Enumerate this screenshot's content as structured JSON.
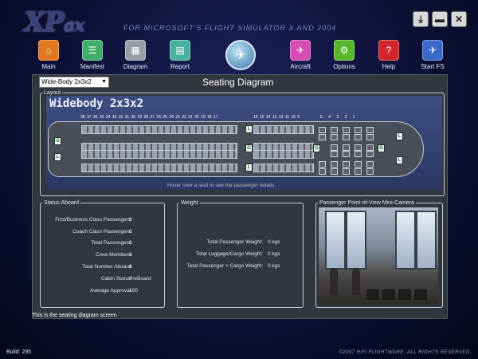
{
  "app": {
    "logo_main": "XP",
    "logo_suffix": "ax",
    "subtitle": "FOR MICROSOFT'S FLIGHT SIMULATOR X AND 2004",
    "window_buttons": [
      "download-icon",
      "minimize-icon",
      "close-icon"
    ]
  },
  "nav": {
    "left": [
      {
        "label": "Main",
        "icon": "home-icon",
        "color": "#e3791f"
      },
      {
        "label": "Manifest",
        "icon": "manifest-icon",
        "color": "#3fae6b"
      },
      {
        "label": "Diagram",
        "icon": "diagram-icon",
        "color": "#9a9ea6"
      },
      {
        "label": "Report",
        "icon": "report-icon",
        "color": "#47b2a2"
      }
    ],
    "right": [
      {
        "label": "Aircraft",
        "icon": "aircraft-icon",
        "color": "#d64db6"
      },
      {
        "label": "Options",
        "icon": "options-icon",
        "color": "#58b82a"
      },
      {
        "label": "Help",
        "icon": "help-icon",
        "color": "#d1262b"
      },
      {
        "label": "Start FS",
        "icon": "plane-icon",
        "color": "#3a69c9"
      }
    ]
  },
  "diagram": {
    "aircraft_select": "Wide-Body 2x3x2",
    "title": "Seating Diagram"
  },
  "layout": {
    "legend": "Layout",
    "aircraft_title": "Widebody 2x3x2",
    "rows_coach_left": "38 37 36 35 34 33 32 31 30 29 28 27 26 25 24 23 22 21 20 19 18 17",
    "rows_coach_right": "16 15 14 13 12 11 10 9",
    "rows_first": "5      4      3      2      1",
    "hint": "Hover over a seat to see the passenger details."
  },
  "status": {
    "legend": "Status Aboard",
    "rows": [
      {
        "label": "First/Business Class Passengers:",
        "value": "0"
      },
      {
        "label": "Coach Class Passengers:",
        "value": "0"
      },
      {
        "label": "Total Passengers:",
        "value": "0"
      },
      {
        "label": "Crew Members:",
        "value": "8"
      },
      {
        "label": "Total Number Aboard:",
        "value": "8"
      },
      {
        "label": "Cabin Status:",
        "value": "PreBoard"
      },
      {
        "label": "Average Approval:",
        "value": "100"
      }
    ]
  },
  "weight": {
    "legend": "Weight",
    "rows": [
      {
        "label": "Total Passenger Weight:",
        "value": "0 kgs"
      },
      {
        "label": "Total Luggage/Cargo Weight:",
        "value": "0 kgs"
      },
      {
        "label": "Total Passenger + Cargo Weight:",
        "value": "0 kgs"
      }
    ]
  },
  "camera": {
    "legend": "Passenger Point-of-View Mini-Camera"
  },
  "statusbar": "This is the seating diagram screen",
  "footer": {
    "build": "Build: 295",
    "copyright": "©2007 HiFi FLIGHTWARE. ALL RIGHTS RESERVED."
  }
}
